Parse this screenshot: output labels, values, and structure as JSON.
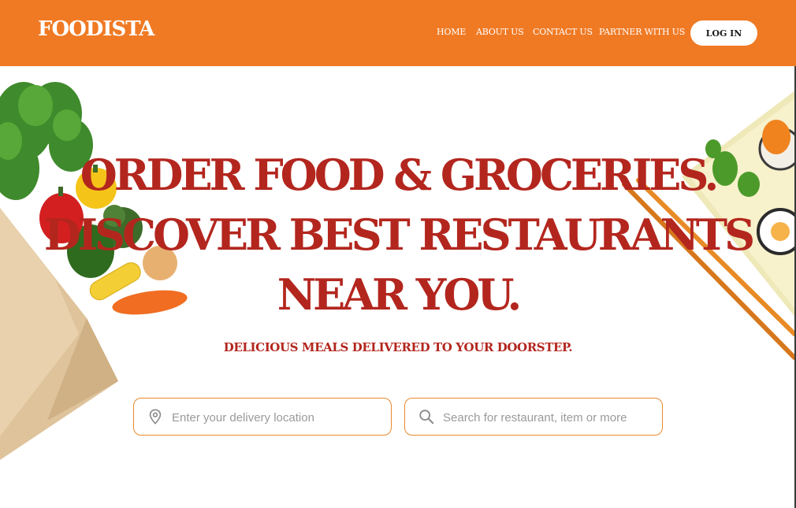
{
  "brand": {
    "logo_text": "FOODISTA"
  },
  "nav": {
    "items": [
      {
        "label": "HOME"
      },
      {
        "label": "ABOUT US"
      },
      {
        "label": "CONTACT US"
      },
      {
        "label": "PARTNER WITH US"
      }
    ],
    "login_label": "LOG IN"
  },
  "hero": {
    "title_lines": [
      "ORDER FOOD & GROCERIES.",
      "DISCOVER BEST RESTAURANTS",
      "NEAR YOU."
    ],
    "subtitle": "DELICIOUS MEALS DELIVERED TO YOUR DOORSTEP."
  },
  "search": {
    "location_placeholder": "Enter your delivery location",
    "query_placeholder": "Search for restaurant, item or more",
    "location_icon": "location-pin-icon",
    "query_icon": "search-icon"
  },
  "colors": {
    "brand_orange": "#f07a24",
    "headline_red": "#b3261e",
    "field_border": "#e8892e"
  }
}
